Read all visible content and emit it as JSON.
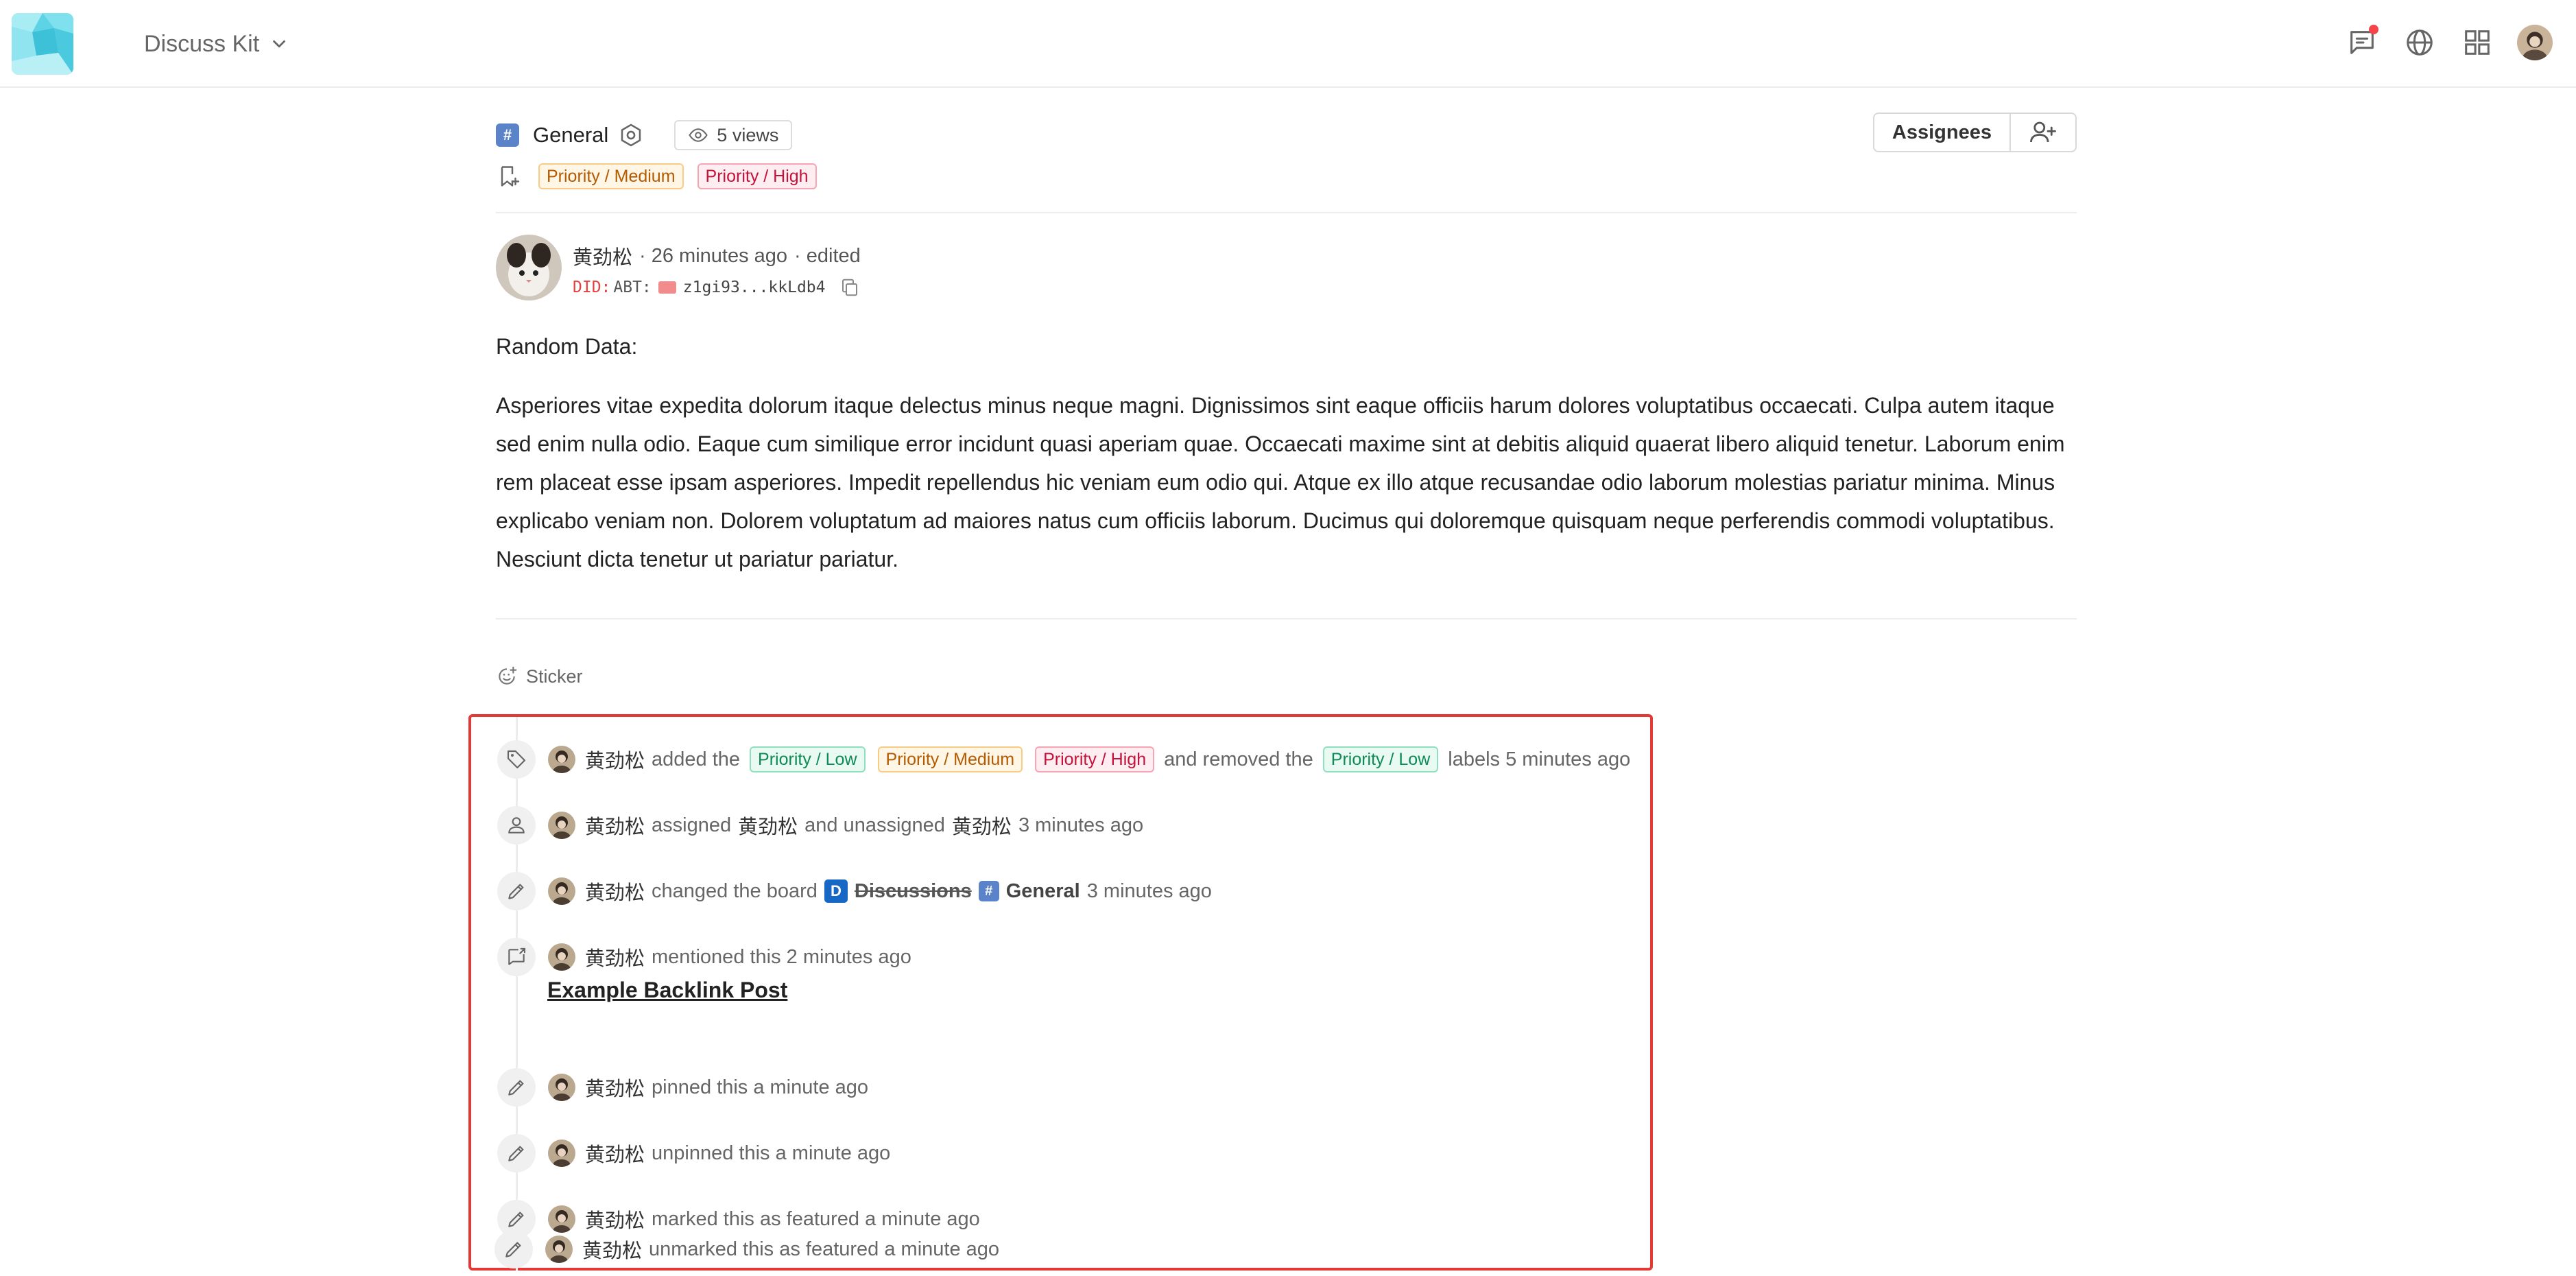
{
  "header": {
    "app_name": "Discuss Kit"
  },
  "post": {
    "board_name": "General",
    "views": "5 views",
    "assignees_label": "Assignees",
    "labels": [
      "Priority / Medium",
      "Priority / High"
    ],
    "author": {
      "name": "黄劲松",
      "time": "· 26 minutes ago",
      "edited": "· edited",
      "did_prefix": "DID:",
      "did_abt": "ABT:",
      "did_short": "z1gi93...kkLdb4"
    },
    "content": [
      "Random Data:",
      "Asperiores vitae expedita dolorum itaque delectus minus neque magni. Dignissimos sint eaque officiis harum dolores voluptatibus occaecati. Culpa autem itaque sed enim nulla odio. Eaque cum similique error incidunt quasi aperiam quae. Occaecati maxime sint at debitis aliquid quaerat libero aliquid tenetur. Laborum enim rem placeat esse ipsam asperiores. Impedit repellendus hic veniam eum odio qui. Atque ex illo atque recusandae odio laborum molestias pariatur minima. Minus explicabo veniam non. Dolorem voluptatum ad maiores natus cum officiis laborum. Ducimus qui doloremque quisquam neque perferendis commodi voluptatibus. Nesciunt dicta tenetur ut pariatur pariatur."
    ],
    "sticker_label": "Sticker"
  },
  "timeline": {
    "user": "黄劲松",
    "e1": {
      "added": "added the",
      "labels_added": [
        "Priority / Low",
        "Priority / Medium",
        "Priority / High"
      ],
      "removed": "and removed the",
      "label_removed": "Priority / Low",
      "tail": "labels 5 minutes ago"
    },
    "e2": {
      "assigned": "assigned",
      "assignee": "黄劲松",
      "unassigned": "and unassigned",
      "unassignee": "黄劲松",
      "time": "3 minutes ago"
    },
    "e3": {
      "text": "changed the board",
      "from_badge": "D",
      "from": "Discussions",
      "to_badge": "#",
      "to": "General",
      "time": "3 minutes ago"
    },
    "e4": {
      "text": "mentioned this 2 minutes ago",
      "link": "Example Backlink Post"
    },
    "e5": {
      "text": "pinned this a minute ago"
    },
    "e6": {
      "text": "unpinned this a minute ago"
    },
    "e7": {
      "text": "marked this as featured a minute ago"
    },
    "e8": {
      "text": "unmarked this as featured a minute ago"
    }
  },
  "icons": {
    "board": "hash-icon",
    "settings": "gear-icon",
    "views": "eye-icon",
    "chat": "chat-icon",
    "language": "globe-icon",
    "apps": "grid-icon"
  }
}
